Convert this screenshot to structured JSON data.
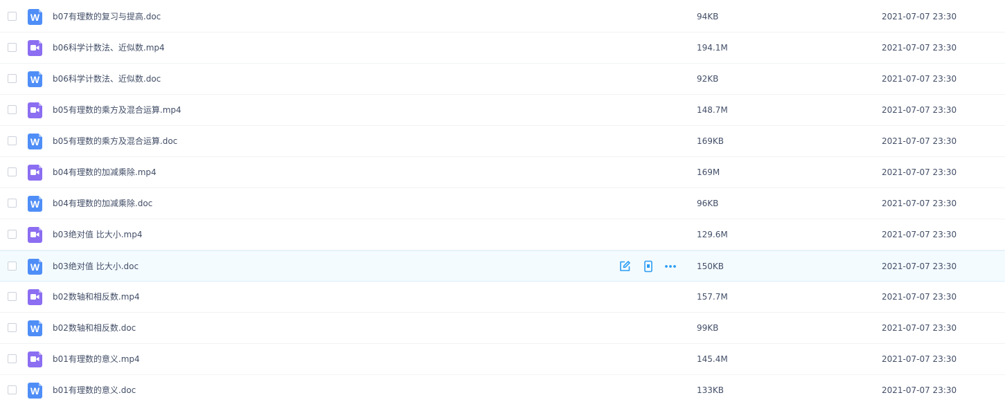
{
  "colors": {
    "doc_icon": "#4f8ef7",
    "video_icon": "#8b6ef1",
    "action_icon": "#2b9cf2",
    "text": "#424e67",
    "hover_row": "#f4fbff"
  },
  "icons": {
    "doc_glyph": "W",
    "doc": "word-doc-icon",
    "video": "video-file-icon",
    "edit": "edit-icon",
    "phone": "send-to-phone-icon",
    "more": "more-icon"
  },
  "files": [
    {
      "name": "b07有理数的复习与提高.doc",
      "type": "doc",
      "size": "94KB",
      "date": "2021-07-07 23:30"
    },
    {
      "name": "b06科学计数法、近似数.mp4",
      "type": "video",
      "size": "194.1M",
      "date": "2021-07-07 23:30"
    },
    {
      "name": "b06科学计数法、近似数.doc",
      "type": "doc",
      "size": "92KB",
      "date": "2021-07-07 23:30"
    },
    {
      "name": "b05有理数的乘方及混合运算.mp4",
      "type": "video",
      "size": "148.7M",
      "date": "2021-07-07 23:30"
    },
    {
      "name": "b05有理数的乘方及混合运算.doc",
      "type": "doc",
      "size": "169KB",
      "date": "2021-07-07 23:30"
    },
    {
      "name": "b04有理数的加减乘除.mp4",
      "type": "video",
      "size": "169M",
      "date": "2021-07-07 23:30"
    },
    {
      "name": "b04有理数的加减乘除.doc",
      "type": "doc",
      "size": "96KB",
      "date": "2021-07-07 23:30"
    },
    {
      "name": "b03绝对值 比大小.mp4",
      "type": "video",
      "size": "129.6M",
      "date": "2021-07-07 23:30"
    },
    {
      "name": "b03绝对值 比大小.doc",
      "type": "doc",
      "size": "150KB",
      "date": "2021-07-07 23:30",
      "hover": true
    },
    {
      "name": "b02数轴和相反数.mp4",
      "type": "video",
      "size": "157.7M",
      "date": "2021-07-07 23:30"
    },
    {
      "name": "b02数轴和相反数.doc",
      "type": "doc",
      "size": "99KB",
      "date": "2021-07-07 23:30"
    },
    {
      "name": "b01有理数的意义.mp4",
      "type": "video",
      "size": "145.4M",
      "date": "2021-07-07 23:30"
    },
    {
      "name": "b01有理数的意义.doc",
      "type": "doc",
      "size": "133KB",
      "date": "2021-07-07 23:30"
    }
  ]
}
